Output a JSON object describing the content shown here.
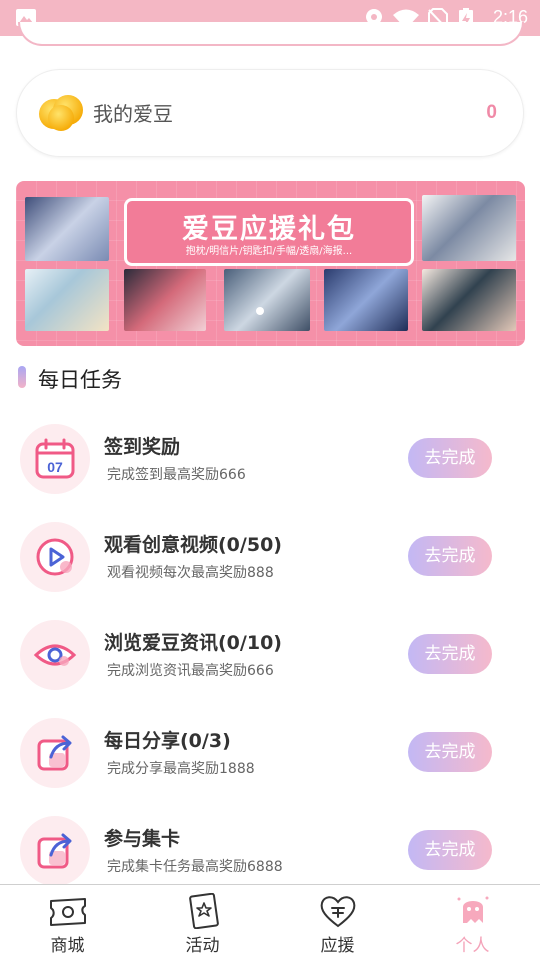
{
  "status_bar": {
    "time": "2:16"
  },
  "idol_card": {
    "label": "我的爱豆",
    "count": "0"
  },
  "banner": {
    "title": "爱豆应援礼包",
    "subtitle": "抱枕/明信片/钥匙扣/手幅/透扇/海报..."
  },
  "daily_tasks": {
    "title": "每日任务",
    "items": [
      {
        "title": "签到奖励",
        "desc": "完成签到最高奖励666",
        "button": "去完成",
        "icon": "calendar-icon"
      },
      {
        "title": "观看创意视频(0/50)",
        "desc": "观看视频每次最高奖励888",
        "button": "去完成",
        "icon": "play-icon"
      },
      {
        "title": "浏览爱豆资讯(0/10)",
        "desc": "完成浏览资讯最高奖励666",
        "button": "去完成",
        "icon": "eye-icon"
      },
      {
        "title": "每日分享(0/3)",
        "desc": "完成分享最高奖励1888",
        "button": "去完成",
        "icon": "share-icon"
      },
      {
        "title": "参与集卡",
        "desc": "完成集卡任务最高奖励6888",
        "button": "去完成",
        "icon": "share-icon"
      }
    ]
  },
  "tabbar": {
    "items": [
      {
        "label": "商城",
        "icon": "ticket-icon"
      },
      {
        "label": "活动",
        "icon": "card-star-icon"
      },
      {
        "label": "应援",
        "icon": "heart-icon"
      },
      {
        "label": "个人",
        "icon": "ghost-icon"
      }
    ],
    "active": "个人"
  },
  "colors": {
    "status_bar": "#f4b7c4",
    "accent_pink": "#f08aa7",
    "banner_bg": "#f590a8",
    "button_gradient_start": "#c3b8f4",
    "button_gradient_end": "#f5b9cc",
    "active_tab": "#f4a3b9"
  }
}
